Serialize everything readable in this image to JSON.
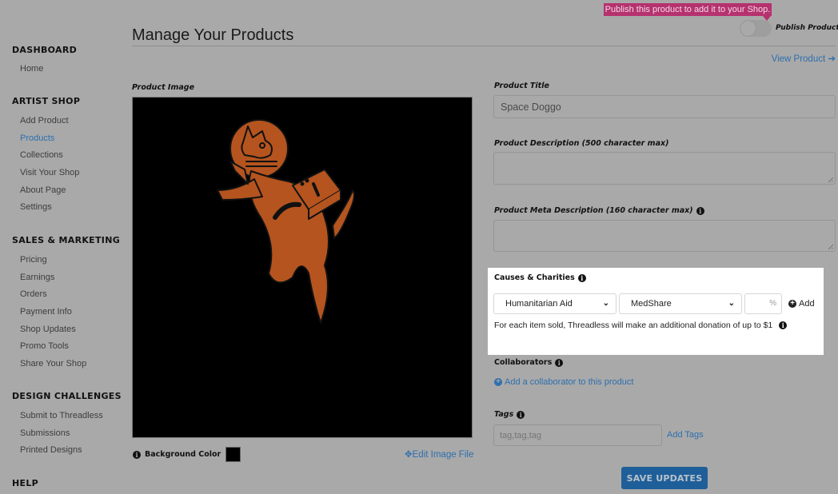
{
  "header": {
    "title": "Manage Your Products",
    "tooltip": "Publish this product to add it to your Shop.",
    "publish_toggle_label": "Publish Product",
    "publish_toggle_on": false,
    "view_product_label": "View Product"
  },
  "sidebar": {
    "sections": [
      {
        "title": "DASHBOARD",
        "items": [
          {
            "label": "Home",
            "active": false
          }
        ]
      },
      {
        "title": "ARTIST SHOP",
        "items": [
          {
            "label": "Add Product",
            "active": false
          },
          {
            "label": "Products",
            "active": true
          },
          {
            "label": "Collections",
            "active": false
          },
          {
            "label": "Visit Your Shop",
            "active": false
          },
          {
            "label": "About Page",
            "active": false
          },
          {
            "label": "Settings",
            "active": false
          }
        ]
      },
      {
        "title": "SALES & MARKETING",
        "items": [
          {
            "label": "Pricing",
            "active": false
          },
          {
            "label": "Earnings",
            "active": false
          },
          {
            "label": "Orders",
            "active": false
          },
          {
            "label": "Payment Info",
            "active": false
          },
          {
            "label": "Shop Updates",
            "active": false
          },
          {
            "label": "Promo Tools",
            "active": false
          },
          {
            "label": "Share Your Shop",
            "active": false
          }
        ]
      },
      {
        "title": "DESIGN CHALLENGES",
        "items": [
          {
            "label": "Submit to Threadless",
            "active": false
          },
          {
            "label": "Submissions",
            "active": false
          },
          {
            "label": "Printed Designs",
            "active": false
          }
        ]
      },
      {
        "title": "HELP",
        "items": []
      }
    ]
  },
  "image_section": {
    "label": "Product Image",
    "background_color_label": "Background Color",
    "background_color": "#000000",
    "edit_image_label": "Edit Image File",
    "artwork_color": "#b5541f"
  },
  "form": {
    "title_label": "Product Title",
    "title_value": "Space Doggo",
    "description_label": "Product Description (500 character max)",
    "description_value": "",
    "meta_label": "Product Meta Description (160 character max)",
    "meta_value": "",
    "charities": {
      "label": "Causes & Charities",
      "cause_selected": "Humanitarian Aid",
      "charity_selected": "MedShare",
      "percent_placeholder": "%",
      "add_label": "Add",
      "donation_note": "For each item sold, Threadless will make an additional donation of up to $1"
    },
    "collaborators_label": "Collaborators",
    "add_collaborator_label": "Add a collaborator to this product",
    "tags_label": "Tags",
    "tags_placeholder": "tag,tag,tag",
    "add_tags_label": "Add Tags",
    "save_label": "SAVE UPDATES"
  },
  "colors": {
    "link": "#2d6fae",
    "tooltip": "#b5326f",
    "save_button": "#1f5f99"
  }
}
